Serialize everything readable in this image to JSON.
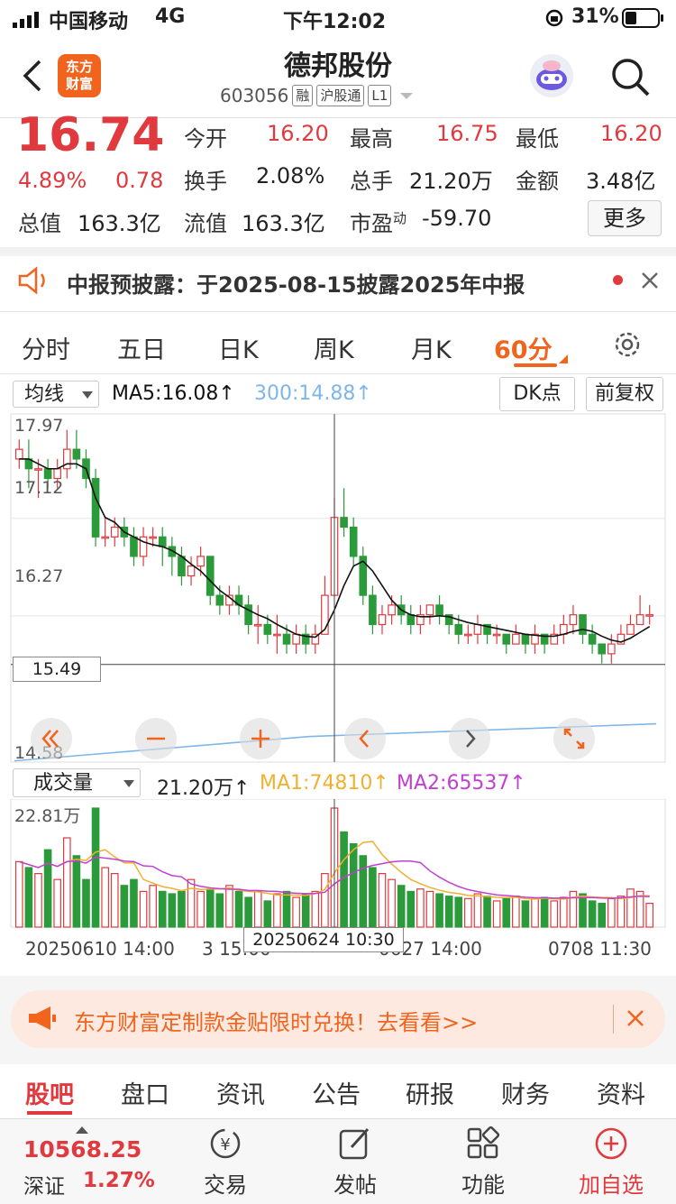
{
  "status_bar": {
    "carrier": "中国移动",
    "network": "4G",
    "time": "下午12:02",
    "battery": "31%"
  },
  "header": {
    "back_icon": "chevron-left-icon",
    "logo": "东方\n财富",
    "stock_name": "德邦股份",
    "stock_code": "603056",
    "tags": [
      "融",
      "沪股通",
      "L1"
    ]
  },
  "quote": {
    "price": "16.74",
    "change_pct": "4.89%",
    "change": "0.78",
    "open_label": "今开",
    "open": "16.20",
    "high_label": "最高",
    "high": "16.75",
    "low_label": "最低",
    "low": "16.20",
    "turnover_label": "换手",
    "turnover": "2.08%",
    "volume_label": "总手",
    "volume": "21.20万",
    "amount_label": "金额",
    "amount": "3.48亿",
    "mcap_label": "总值",
    "mcap": "163.3亿",
    "float_label": "流值",
    "float": "163.3亿",
    "pe_label": "市盈",
    "pe_sup": "动",
    "pe": "-59.70",
    "more": "更多"
  },
  "notice": {
    "text": "中报预披露：于2025-08-15披露2025年中报"
  },
  "chart_tabs": [
    "分时",
    "五日",
    "日K",
    "周K",
    "月K",
    "60分"
  ],
  "chart_tab_active": "60分",
  "indicators": {
    "ma_select": "均线",
    "ma5": "MA5:16.08↑",
    "ma300": "300:14.88↑",
    "dk": "DK点",
    "adjust": "前复权"
  },
  "kline_axis": {
    "y_labels": [
      "17.97",
      "17.12",
      "16.27",
      "14.58"
    ],
    "crosshair_price": "15.49"
  },
  "volume_panel": {
    "select": "成交量",
    "value": "21.20万↑",
    "ma1": "MA1:74810↑",
    "ma2": "MA2:65537↑",
    "max_label": "22.81万"
  },
  "time_axis": {
    "labels": [
      "20250610 14:00",
      "3 15:00",
      "0627 14:00",
      "0708 11:30"
    ],
    "crosshair_time": "20250624 10:30"
  },
  "ad_banner": {
    "text": "东方财富定制款金贴限时兑换！去看看>>"
  },
  "bottom_tabs": [
    "股吧",
    "盘口",
    "资讯",
    "公告",
    "研报",
    "财务",
    "资料"
  ],
  "bottom_tab_active": "股吧",
  "bottom_nav": {
    "index_value": "10568.25",
    "index_name": "深证",
    "index_change": "1.27%",
    "items": [
      "交易",
      "发帖",
      "功能",
      "加自选"
    ]
  },
  "colors": {
    "up": "#e0393e",
    "down": "#2a9a3a",
    "accent": "#f0641e",
    "ma5": "#111111",
    "ma300": "#7fb6ea",
    "ma1": "#f0b030",
    "ma2": "#c040d0"
  },
  "chart_data": {
    "type": "candlestick",
    "ylim": [
      14.58,
      17.97
    ],
    "candles": [
      [
        17.6,
        17.7,
        17.5,
        17.8
      ],
      [
        17.6,
        17.5,
        17.3,
        17.8
      ],
      [
        17.5,
        17.5,
        17.2,
        17.6
      ],
      [
        17.5,
        17.4,
        17.3,
        17.6
      ],
      [
        17.4,
        17.5,
        17.3,
        17.6
      ],
      [
        17.5,
        17.7,
        17.4,
        17.9
      ],
      [
        17.7,
        17.6,
        17.5,
        17.9
      ],
      [
        17.6,
        17.4,
        17.3,
        17.7
      ],
      [
        17.4,
        16.8,
        16.7,
        17.5
      ],
      [
        16.8,
        16.8,
        16.7,
        17.0
      ],
      [
        16.8,
        16.9,
        16.7,
        17.0
      ],
      [
        16.9,
        16.8,
        16.7,
        17.0
      ],
      [
        16.8,
        16.6,
        16.5,
        16.9
      ],
      [
        16.6,
        16.8,
        16.5,
        16.9
      ],
      [
        16.8,
        16.8,
        16.7,
        16.9
      ],
      [
        16.8,
        16.7,
        16.5,
        16.9
      ],
      [
        16.7,
        16.6,
        16.4,
        16.8
      ],
      [
        16.6,
        16.4,
        16.3,
        16.7
      ],
      [
        16.4,
        16.5,
        16.3,
        16.6
      ],
      [
        16.5,
        16.6,
        16.4,
        16.7
      ],
      [
        16.6,
        16.2,
        16.1,
        16.6
      ],
      [
        16.2,
        16.1,
        16.0,
        16.3
      ],
      [
        16.1,
        16.2,
        16.0,
        16.3
      ],
      [
        16.2,
        16.1,
        16.0,
        16.3
      ],
      [
        16.1,
        15.9,
        15.8,
        16.2
      ],
      [
        15.9,
        15.9,
        15.7,
        16.1
      ],
      [
        15.9,
        15.8,
        15.7,
        16.0
      ],
      [
        15.8,
        15.8,
        15.6,
        16.0
      ],
      [
        15.8,
        15.7,
        15.6,
        15.9
      ],
      [
        15.7,
        15.8,
        15.6,
        15.9
      ],
      [
        15.8,
        15.7,
        15.6,
        15.9
      ],
      [
        15.7,
        15.8,
        15.6,
        15.9
      ],
      [
        15.8,
        16.2,
        15.8,
        16.4
      ],
      [
        16.2,
        17.0,
        16.2,
        17.2
      ],
      [
        17.0,
        16.9,
        16.8,
        17.3
      ],
      [
        16.9,
        16.6,
        16.5,
        17.0
      ],
      [
        16.6,
        16.2,
        16.1,
        16.7
      ],
      [
        16.2,
        15.9,
        15.8,
        16.3
      ],
      [
        15.9,
        16.0,
        15.8,
        16.1
      ],
      [
        16.0,
        16.1,
        15.9,
        16.2
      ],
      [
        16.1,
        16.0,
        15.9,
        16.2
      ],
      [
        16.0,
        15.9,
        15.8,
        16.1
      ],
      [
        15.9,
        16.0,
        15.8,
        16.1
      ],
      [
        16.0,
        16.1,
        15.9,
        16.1
      ],
      [
        16.1,
        16.0,
        15.9,
        16.2
      ],
      [
        16.0,
        15.9,
        15.8,
        16.0
      ],
      [
        15.9,
        15.8,
        15.7,
        16.0
      ],
      [
        15.8,
        15.8,
        15.7,
        15.9
      ],
      [
        15.8,
        15.9,
        15.7,
        16.0
      ],
      [
        15.9,
        15.8,
        15.7,
        15.9
      ],
      [
        15.8,
        15.8,
        15.7,
        15.9
      ],
      [
        15.8,
        15.7,
        15.6,
        15.8
      ],
      [
        15.7,
        15.8,
        15.7,
        15.9
      ],
      [
        15.8,
        15.7,
        15.6,
        15.8
      ],
      [
        15.7,
        15.8,
        15.6,
        15.9
      ],
      [
        15.8,
        15.7,
        15.6,
        15.8
      ],
      [
        15.7,
        15.8,
        15.7,
        15.9
      ],
      [
        15.8,
        15.9,
        15.7,
        16.0
      ],
      [
        15.9,
        16.0,
        15.8,
        16.1
      ],
      [
        16.0,
        15.8,
        15.7,
        16.0
      ],
      [
        15.8,
        15.7,
        15.6,
        15.9
      ],
      [
        15.7,
        15.6,
        15.5,
        15.7
      ],
      [
        15.6,
        15.7,
        15.5,
        15.8
      ],
      [
        15.7,
        15.8,
        15.7,
        15.9
      ],
      [
        15.8,
        15.9,
        15.8,
        16.0
      ],
      [
        15.9,
        16.0,
        15.9,
        16.2
      ],
      [
        16.0,
        16.0,
        15.9,
        16.1
      ]
    ],
    "ma5": [
      17.6,
      17.6,
      17.55,
      17.5,
      17.5,
      17.55,
      17.55,
      17.5,
      17.2,
      17.0,
      16.95,
      16.85,
      16.8,
      16.75,
      16.72,
      16.7,
      16.66,
      16.6,
      16.52,
      16.45,
      16.35,
      16.25,
      16.18,
      16.1,
      16.05,
      16.0,
      15.96,
      15.9,
      15.85,
      15.8,
      15.78,
      15.77,
      15.85,
      16.05,
      16.3,
      16.5,
      16.55,
      16.45,
      16.3,
      16.15,
      16.05,
      16.0,
      15.98,
      15.98,
      15.99,
      15.98,
      15.95,
      15.92,
      15.9,
      15.88,
      15.86,
      15.84,
      15.82,
      15.8,
      15.79,
      15.78,
      15.78,
      15.8,
      15.83,
      15.85,
      15.83,
      15.78,
      15.74,
      15.72,
      15.76,
      15.82,
      15.88
    ],
    "ma300": [
      14.5,
      14.75,
      14.88
    ]
  }
}
